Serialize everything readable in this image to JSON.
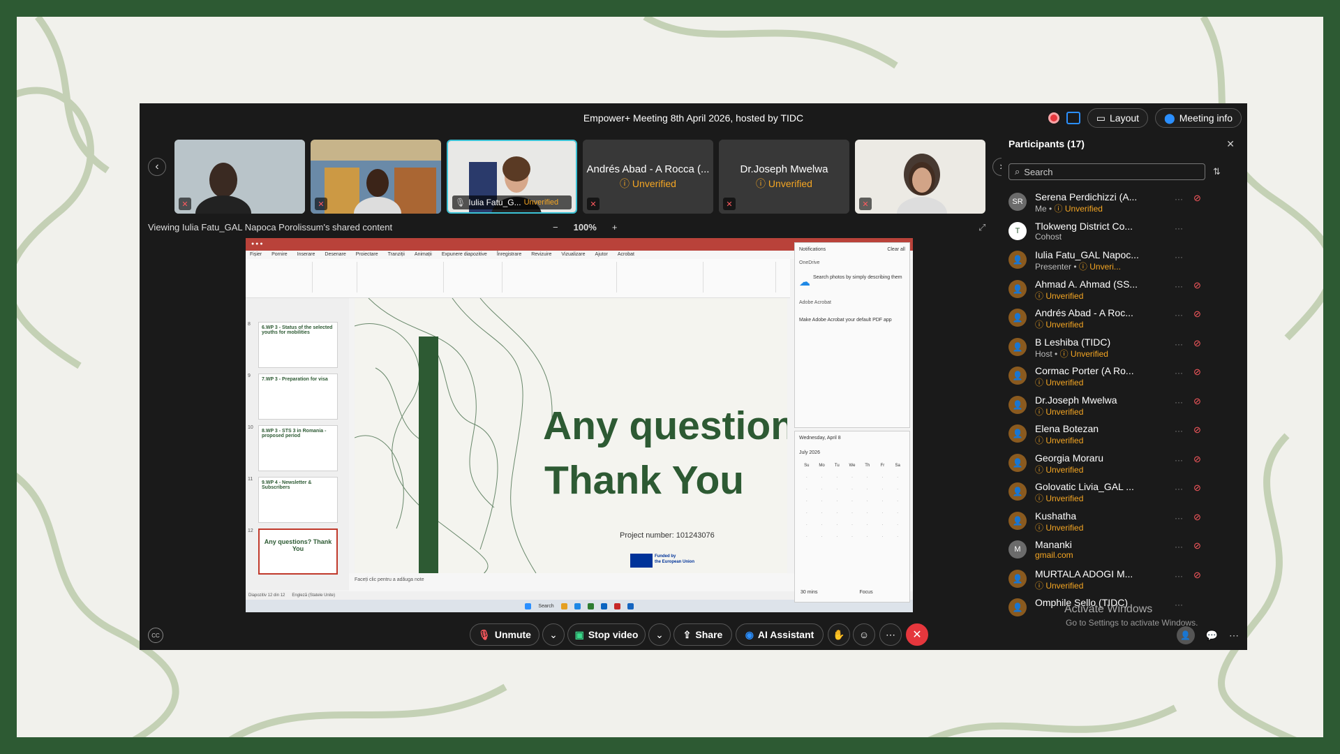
{
  "meeting": {
    "title": "Empower+ Meeting 8th April 2026, hosted by TIDC",
    "layout_label": "Layout",
    "meeting_info_label": "Meeting info",
    "share_caption": "Viewing Iulia Fatu_GAL Napoca Porolissum's shared content",
    "zoom_level": "100%",
    "zoom_minus": "−",
    "zoom_plus": "+"
  },
  "filmstrip": {
    "tiles": [
      {
        "type": "video"
      },
      {
        "type": "video"
      },
      {
        "type": "video",
        "label": "Iulia Fatu_G...",
        "status": "Unverified"
      },
      {
        "type": "name",
        "name": "Andrés Abad - A Rocca (...",
        "status": "Unverified"
      },
      {
        "type": "name",
        "name": "Dr.Joseph Mwelwa",
        "status": "Unverified"
      },
      {
        "type": "video"
      }
    ]
  },
  "slide": {
    "line1": "Any questions?",
    "line2": "Thank You",
    "project_number": "Project number: 101243076",
    "eu_text_1": "Funded by",
    "eu_text_2": "the European Union",
    "notes_placeholder": "Faceți clic pentru a adăuga note",
    "status_left": "Diapozitiv 12 din 12",
    "status_lang": "Engleză (Statele Unite)",
    "thumbs": [
      {
        "num": "8",
        "text": "6.WP 3 - Status of the selected youths for mobilities"
      },
      {
        "num": "9",
        "text": "7.WP 3 - Preparation for visa"
      },
      {
        "num": "10",
        "text": "8.WP 3 - STS 3 in Romania - proposed period"
      },
      {
        "num": "11",
        "text": "9.WP 4 - Newsletter & Subscribers"
      },
      {
        "num": "12",
        "text": "Any questions? Thank You"
      }
    ],
    "menu": [
      "Fișier",
      "Pornire",
      "Inserare",
      "Desenare",
      "Proiectare",
      "Tranziții",
      "Animații",
      "Expunere diapozitive",
      "Înregistrare",
      "Revizuire",
      "Vizualizare",
      "Ajutor",
      "Acrobat"
    ],
    "notif_title": "Notifications",
    "notif_clear": "Clear all",
    "notif_app1": "OneDrive",
    "notif_msg1": "Search photos by simply describing them",
    "notif_app2": "Adobe Acrobat",
    "notif_msg2": "Make Adobe Acrobat your default PDF app",
    "cal_header": "Wednesday, April 8",
    "cal_month": "July 2026",
    "cal_days": [
      "Su",
      "Mo",
      "Tu",
      "We",
      "Th",
      "Fr",
      "Sa"
    ],
    "cal_focus": "30 mins",
    "cal_focus_btn": "Focus",
    "taskbar_search": "Search"
  },
  "participants": {
    "header": "Participants (17)",
    "search_placeholder": "Search",
    "list": [
      {
        "initials": "SR",
        "name": "Serena Perdichizzi (A...",
        "role": "Me",
        "status": "Unverified",
        "avatar": "grey"
      },
      {
        "initials": "T",
        "name": "Tlokweng District Co...",
        "role": "Cohost",
        "status": "",
        "avatar": "logo"
      },
      {
        "initials": "",
        "name": "Iulia Fatu_GAL Napoc...",
        "role": "Presenter",
        "status": "Unveri...",
        "avatar": "orange"
      },
      {
        "initials": "",
        "name": "Ahmad A. Ahmad (SS...",
        "role": "",
        "status": "Unverified",
        "avatar": "orange"
      },
      {
        "initials": "",
        "name": "Andrés Abad - A Roc...",
        "role": "",
        "status": "Unverified",
        "avatar": "orange"
      },
      {
        "initials": "",
        "name": "B Leshiba (TIDC)",
        "role": "Host",
        "status": "Unverified",
        "avatar": "orange"
      },
      {
        "initials": "",
        "name": "Cormac Porter (A Ro...",
        "role": "",
        "status": "Unverified",
        "avatar": "orange"
      },
      {
        "initials": "",
        "name": "Dr.Joseph Mwelwa",
        "role": "",
        "status": "Unverified",
        "avatar": "orange"
      },
      {
        "initials": "",
        "name": "Elena Botezan",
        "role": "",
        "status": "Unverified",
        "avatar": "orange"
      },
      {
        "initials": "",
        "name": "Georgia Moraru",
        "role": "",
        "status": "Unverified",
        "avatar": "orange"
      },
      {
        "initials": "",
        "name": "Golovatic Livia_GAL ...",
        "role": "",
        "status": "Unverified",
        "avatar": "orange"
      },
      {
        "initials": "",
        "name": "Kushatha",
        "role": "",
        "status": "Unverified",
        "avatar": "orange"
      },
      {
        "initials": "M",
        "name": "Mananki",
        "role": "gmail.com",
        "status": "",
        "avatar": "grey"
      },
      {
        "initials": "",
        "name": "MURTALA ADOGI M...",
        "role": "",
        "status": "Unverified",
        "avatar": "orange"
      },
      {
        "initials": "",
        "name": "Omphile Sello (TIDC)",
        "role": "",
        "status": "",
        "avatar": "orange"
      }
    ]
  },
  "watermark": {
    "line1": "Activate Windows",
    "line2": "Go to Settings to activate Windows."
  },
  "controls": {
    "unmute": "Unmute",
    "stop_video": "Stop video",
    "share": "Share",
    "ai_assistant": "AI Assistant"
  },
  "colors": {
    "frame_green": "#2d5a33",
    "unverified": "#f5a623",
    "end_red": "#e5373d",
    "accent_blue": "#2b8fff"
  }
}
